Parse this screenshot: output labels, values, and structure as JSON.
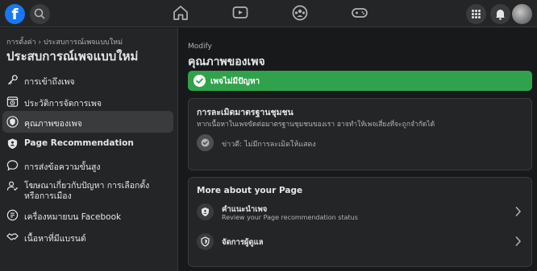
{
  "topbar": {
    "logo": "f",
    "icons": [
      "facebook-logo",
      "search-icon",
      "home-icon",
      "watch-icon",
      "groups-icon",
      "gaming-icon",
      "menu-grid-icon",
      "notifications-icon",
      "avatar"
    ]
  },
  "sidebar": {
    "breadcrumb": "การตั้งค่า › ประสบการณ์เพจแบบใหม่",
    "title": "ประสบการณ์เพจแบบใหม่",
    "items": [
      {
        "label": "การเข้าถึงเพจ",
        "icon": "key-icon"
      },
      {
        "label": "ประวัติการจัดการเพจ",
        "icon": "history-icon"
      },
      {
        "label": "คุณภาพของเพจ",
        "icon": "shield-icon"
      },
      {
        "label": "Page Recommendation",
        "icon": "shield-check-icon"
      },
      {
        "label": "การส่งข้อความขั้นสูง",
        "icon": "chat-icon"
      },
      {
        "label": "โฆษณาเกี่ยวกับปัญหา การเลือกตั้ง",
        "label2": "หรือการเมือง",
        "icon": "election-icon"
      },
      {
        "label": "เครื่องหมายบน Facebook",
        "icon": "tag-icon"
      },
      {
        "label": "เนื้อหาที่มีแบรนด์",
        "icon": "handshake-icon"
      }
    ]
  },
  "main": {
    "section": "Modify",
    "title": "คุณภาพของเพจ",
    "status": "เพจไม่มีปัญหา",
    "standards_card": {
      "title": "การละเมิดมาตรฐานชุมชน",
      "description": "หากเนื้อหาในเพจขัดต่อมาตรฐานชุมชนของเรา อาจทำให้เพจเสี่ยงที่จะถูกจำกัดได้",
      "row_text": "ข่าวดี: ไม่มีการละเมิดให้แสดง"
    },
    "more_card": {
      "title": "More about your Page",
      "rows": [
        {
          "title": "คำแนะนำเพจ",
          "subtitle": "Review your Page recommendation status"
        },
        {
          "title": "จัดการผู้ดูแล",
          "subtitle": ""
        }
      ]
    }
  },
  "colors": {
    "accent": "#1877f2",
    "success": "#31a24c",
    "background": "#18191a",
    "surface": "#242526"
  }
}
